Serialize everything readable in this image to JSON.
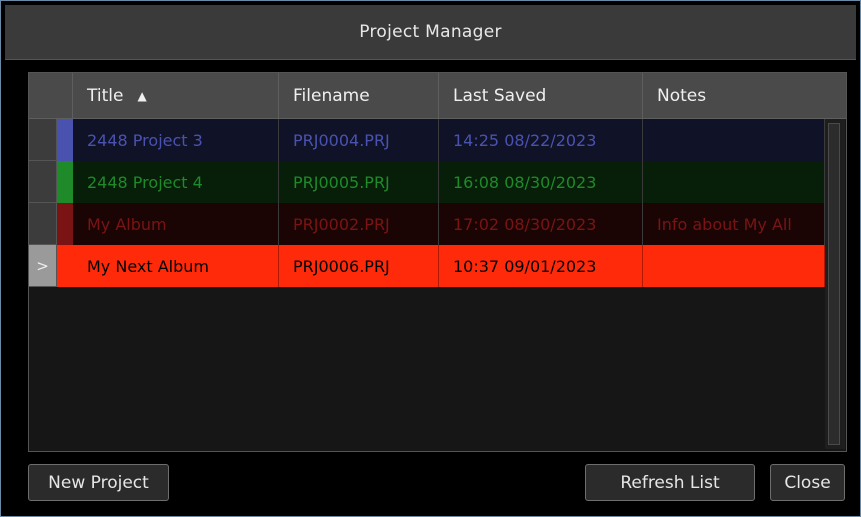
{
  "window": {
    "title": "Project Manager"
  },
  "table": {
    "columns": [
      {
        "label": "Title",
        "sort": "ascending"
      },
      {
        "label": "Filename"
      },
      {
        "label": "Last Saved"
      },
      {
        "label": "Notes"
      }
    ],
    "rows": [
      {
        "title": "2448 Project 3",
        "filename": "PRJ0004.PRJ",
        "last_saved": "14:25 08/22/2023",
        "notes": "",
        "color": "#4a52b0",
        "selected": false,
        "marker": ""
      },
      {
        "title": "2448 Project 4",
        "filename": "PRJ0005.PRJ",
        "last_saved": "16:08 08/30/2023",
        "notes": "",
        "color": "#1f8a2a",
        "selected": false,
        "marker": ""
      },
      {
        "title": "My Album",
        "filename": "PRJ0002.PRJ",
        "last_saved": "17:02 08/30/2023",
        "notes": "Info about My All",
        "color": "#7a1414",
        "selected": false,
        "marker": ""
      },
      {
        "title": "My Next Album",
        "filename": "PRJ0006.PRJ",
        "last_saved": "10:37 09/01/2023",
        "notes": "",
        "color": "#ff2a0a",
        "selected": true,
        "marker": ">"
      }
    ]
  },
  "buttons": {
    "new_project": "New Project",
    "refresh_list": "Refresh List",
    "close": "Close"
  }
}
